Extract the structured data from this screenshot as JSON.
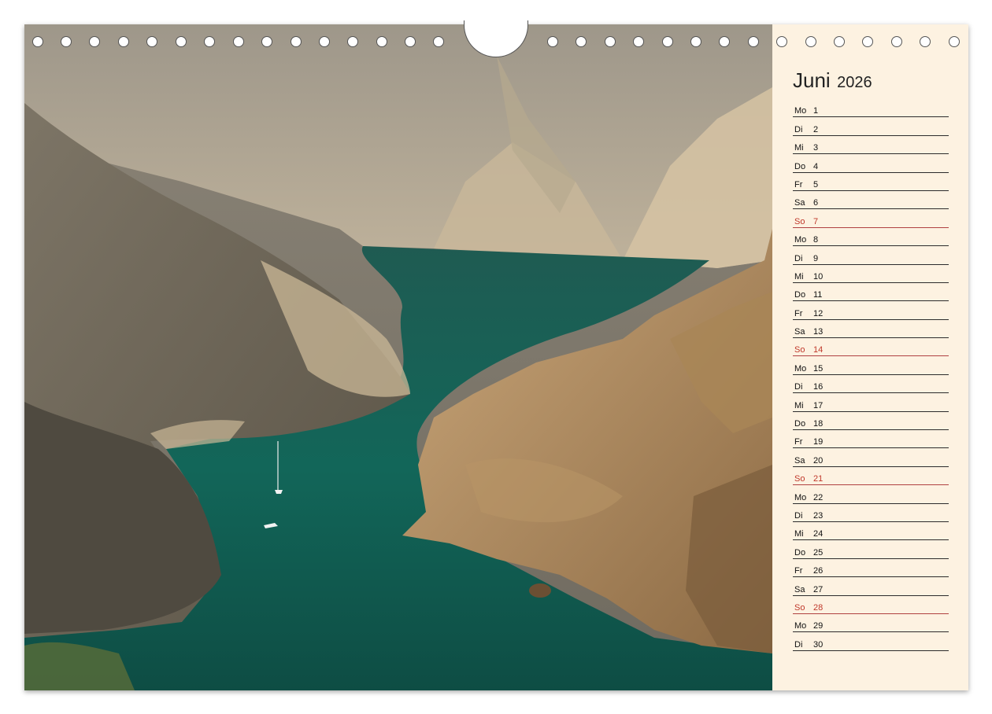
{
  "calendar": {
    "month": "Juni",
    "year": "2026",
    "accent_sunday": "#c0392b",
    "panel_color": "#fdf2e1",
    "days": [
      {
        "wd": "Mo",
        "d": "1"
      },
      {
        "wd": "Di",
        "d": "2"
      },
      {
        "wd": "Mi",
        "d": "3"
      },
      {
        "wd": "Do",
        "d": "4"
      },
      {
        "wd": "Fr",
        "d": "5"
      },
      {
        "wd": "Sa",
        "d": "6"
      },
      {
        "wd": "So",
        "d": "7"
      },
      {
        "wd": "Mo",
        "d": "8"
      },
      {
        "wd": "Di",
        "d": "9"
      },
      {
        "wd": "Mi",
        "d": "10"
      },
      {
        "wd": "Do",
        "d": "11"
      },
      {
        "wd": "Fr",
        "d": "12"
      },
      {
        "wd": "Sa",
        "d": "13"
      },
      {
        "wd": "So",
        "d": "14"
      },
      {
        "wd": "Mo",
        "d": "15"
      },
      {
        "wd": "Di",
        "d": "16"
      },
      {
        "wd": "Mi",
        "d": "17"
      },
      {
        "wd": "Do",
        "d": "18"
      },
      {
        "wd": "Fr",
        "d": "19"
      },
      {
        "wd": "Sa",
        "d": "20"
      },
      {
        "wd": "So",
        "d": "21"
      },
      {
        "wd": "Mo",
        "d": "22"
      },
      {
        "wd": "Di",
        "d": "23"
      },
      {
        "wd": "Mi",
        "d": "24"
      },
      {
        "wd": "Do",
        "d": "25"
      },
      {
        "wd": "Fr",
        "d": "26"
      },
      {
        "wd": "Sa",
        "d": "27"
      },
      {
        "wd": "So",
        "d": "28"
      },
      {
        "wd": "Mo",
        "d": "29"
      },
      {
        "wd": "Di",
        "d": "30"
      }
    ]
  },
  "photo": {
    "subject": "river-canyon-landscape"
  }
}
